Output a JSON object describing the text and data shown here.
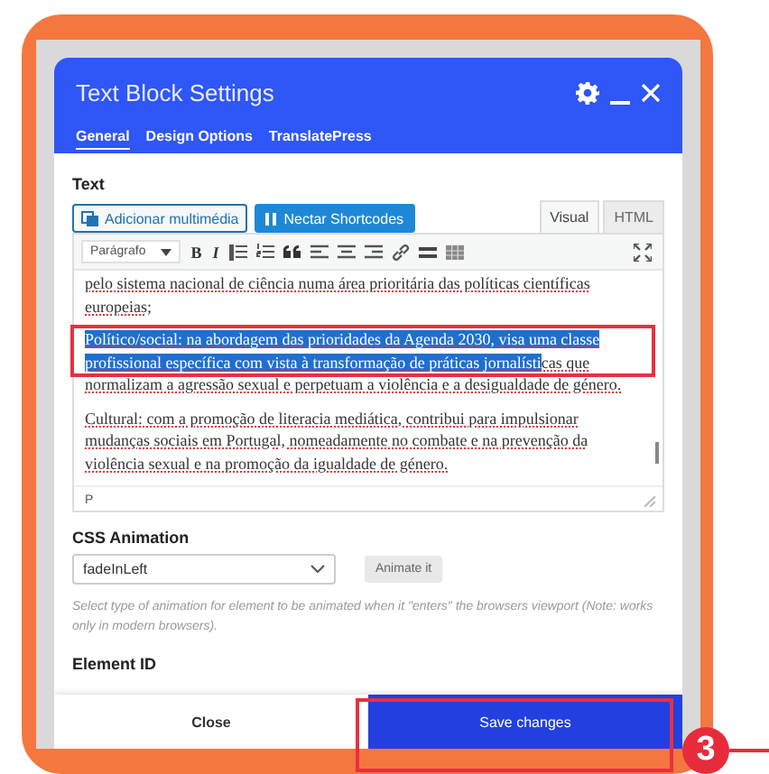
{
  "dialog": {
    "title": "Text Block Settings",
    "tabs": [
      {
        "label": "General",
        "selected": true
      },
      {
        "label": "Design Options",
        "selected": false
      },
      {
        "label": "TranslatePress",
        "selected": false
      }
    ]
  },
  "text_field": {
    "label": "Text",
    "media_button": "Adicionar multimédia",
    "shortcodes_button": "Nectar Shortcodes",
    "editor_tabs": [
      {
        "label": "Visual",
        "selected": true
      },
      {
        "label": "HTML",
        "selected": false
      }
    ],
    "format_select": "Parágrafo",
    "glyph_buttons": [
      "B",
      "I"
    ],
    "paragraphs": [
      {
        "text": "pelo sistema nacional de ciência numa área prioritária das políticas científicas europeias;"
      },
      {
        "selected_text": "Político/social: na abordagem das prioridades da Agenda 2030, visa uma classe profissional específica com vista à transformação de práticas jornalísti",
        "text": "cas que normalizam a agressão sexual e perpetuam a violência e a desigualdade de género."
      },
      {
        "text": "Cultural: com a promoção de literacia mediática, contribui para impulsionar mudanças sociais em Portugal, nomeadamente no combate e na prevenção da violência sexual e na promoção da igualdade de género."
      }
    ],
    "path": "P"
  },
  "css_animation": {
    "label": "CSS Animation",
    "value": "fadeInLeft",
    "button": "Animate it",
    "hint": "Select type of animation for element to be animated when it \"enters\" the browsers viewport (Note: works only in modern browsers)."
  },
  "element_id": {
    "label": "Element ID"
  },
  "footer": {
    "close": "Close",
    "save": "Save changes"
  },
  "annotation": {
    "step": "3"
  }
}
